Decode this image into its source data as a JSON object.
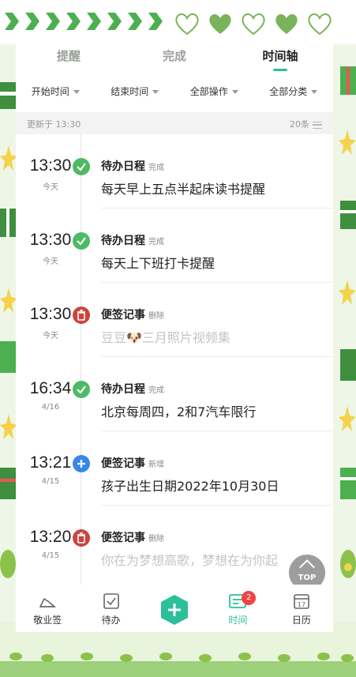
{
  "tabs": [
    {
      "label": "提醒"
    },
    {
      "label": "完成"
    },
    {
      "label": "时间轴"
    }
  ],
  "filters": [
    {
      "label": "开始时间"
    },
    {
      "label": "结束时间"
    },
    {
      "label": "全部操作"
    },
    {
      "label": "全部分类"
    }
  ],
  "status": {
    "updated_label": "更新于",
    "updated_time": "13:30",
    "count": "20条"
  },
  "entries": [
    {
      "time": "13:30",
      "date": "今天",
      "category": "待办日程",
      "action": "完成",
      "content": "每天早上五点半起床读书提醒",
      "icon": "check-icon"
    },
    {
      "time": "13:30",
      "date": "今天",
      "category": "待办日程",
      "action": "完成",
      "content": "每天上下班打卡提醒",
      "icon": "check-icon"
    },
    {
      "time": "13:30",
      "date": "今天",
      "category": "便签记事",
      "action": "删除",
      "content": "豆豆🐶三月照片视频集",
      "icon": "trash-icon"
    },
    {
      "time": "16:34",
      "date": "4/16",
      "category": "待办日程",
      "action": "完成",
      "content": "北京每周四，2和7汽车限行",
      "icon": "check-icon"
    },
    {
      "time": "13:21",
      "date": "4/15",
      "category": "便签记事",
      "action": "新增",
      "content": "孩子出生日期2022年10月30日",
      "icon": "plus-icon"
    },
    {
      "time": "13:20",
      "date": "4/15",
      "category": "便签记事",
      "action": "删除",
      "content": "你在为梦想高歌，梦想在为你起",
      "icon": "trash-icon"
    }
  ],
  "top_button": {
    "label": "TOP"
  },
  "nav": [
    {
      "label": "敬业签"
    },
    {
      "label": "待办"
    },
    {
      "label": ""
    },
    {
      "label": "时间",
      "badge": "2"
    },
    {
      "label": "日历",
      "calendar_day": "17"
    }
  ],
  "colors": {
    "accent": "#2bbf9a",
    "check": "#4cbb63",
    "trash": "#c9453f",
    "plus": "#3a86e8",
    "badge": "#ee4444"
  }
}
